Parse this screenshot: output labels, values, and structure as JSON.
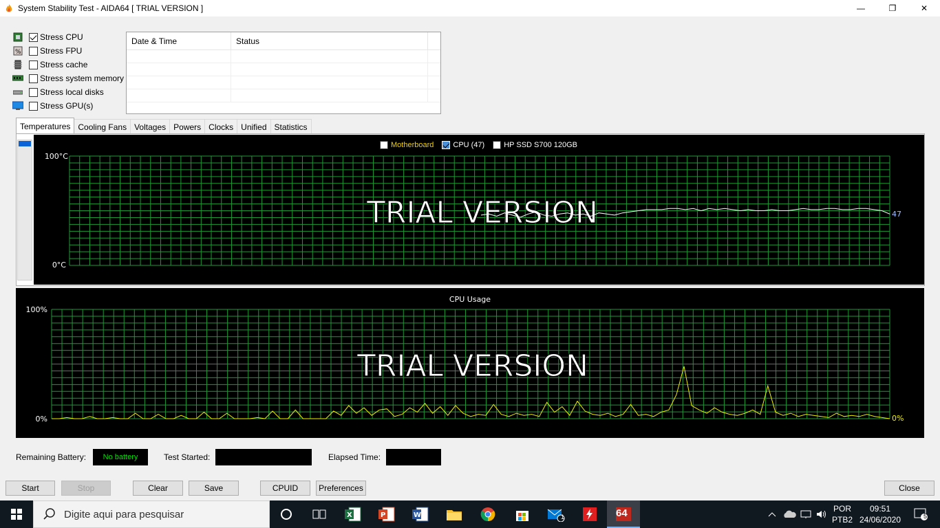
{
  "window": {
    "title": "System Stability Test - AIDA64  [ TRIAL VERSION ]",
    "minimize": "—",
    "maximize": "❐",
    "close": "✕"
  },
  "stress_options": [
    {
      "label": "Stress CPU",
      "checked": true,
      "icon": "cpu-icon"
    },
    {
      "label": "Stress FPU",
      "checked": false,
      "icon": "fpu-icon"
    },
    {
      "label": "Stress cache",
      "checked": false,
      "icon": "cache-icon"
    },
    {
      "label": "Stress system memory",
      "checked": false,
      "icon": "memory-icon"
    },
    {
      "label": "Stress local disks",
      "checked": false,
      "icon": "disk-icon"
    },
    {
      "label": "Stress GPU(s)",
      "checked": false,
      "icon": "gpu-icon"
    }
  ],
  "log": {
    "columns": [
      "Date & Time",
      "Status"
    ]
  },
  "tabs": [
    "Temperatures",
    "Cooling Fans",
    "Voltages",
    "Powers",
    "Clocks",
    "Unified",
    "Statistics"
  ],
  "temp_graph": {
    "legend": [
      {
        "label": "Motherboard",
        "checked": false,
        "color": "#f0d000"
      },
      {
        "label": "CPU (47)",
        "checked": true,
        "color": "#ffffff"
      },
      {
        "label": "HP SSD S700 120GB",
        "checked": false,
        "color": "#ffffff"
      }
    ],
    "y_top": "100°C",
    "y_bottom": "0°C",
    "current": "47",
    "watermark": "TRIAL VERSION"
  },
  "cpu_graph": {
    "title": "CPU Usage",
    "y_top": "100%",
    "y_bottom": "0%",
    "current": "0%",
    "watermark": "TRIAL VERSION"
  },
  "chart_data": [
    {
      "type": "line",
      "title": "",
      "ylim": [
        0,
        100
      ],
      "series": [
        {
          "name": "CPU (47)",
          "values": [
            46,
            47,
            45,
            48,
            46,
            44,
            47,
            49,
            46,
            45,
            47,
            48,
            46,
            47,
            45,
            48,
            47,
            46,
            48,
            49,
            50,
            51,
            51,
            51,
            52,
            52,
            51,
            52,
            50,
            52,
            51,
            52,
            51,
            50,
            51,
            50,
            50,
            51,
            50,
            50,
            51,
            52,
            51,
            51,
            52,
            52,
            51,
            51,
            52,
            52,
            51,
            50,
            47
          ]
        }
      ]
    },
    {
      "type": "line",
      "title": "CPU Usage",
      "ylim": [
        0,
        100
      ],
      "series": [
        {
          "name": "CPU Usage",
          "values": [
            0,
            0,
            1,
            0,
            0,
            2,
            0,
            0,
            1,
            0,
            0,
            5,
            0,
            0,
            4,
            0,
            0,
            3,
            0,
            0,
            6,
            0,
            0,
            5,
            0,
            0,
            0,
            1,
            0,
            7,
            0,
            0,
            8,
            0,
            0,
            0,
            0,
            7,
            3,
            12,
            5,
            10,
            3,
            8,
            9,
            2,
            4,
            10,
            6,
            14,
            5,
            11,
            3,
            12,
            5,
            2,
            4,
            3,
            13,
            4,
            2,
            5,
            3,
            4,
            2,
            15,
            6,
            11,
            3,
            16,
            7,
            4,
            3,
            5,
            2,
            4,
            13,
            3,
            4,
            2,
            6,
            8,
            22,
            48,
            12,
            8,
            5,
            10,
            6,
            4,
            3,
            5,
            8,
            4,
            30,
            6,
            3,
            5,
            2,
            4,
            3,
            2,
            1,
            5,
            2,
            3,
            2,
            4,
            2,
            1,
            0
          ]
        }
      ]
    }
  ],
  "status": {
    "battery_label": "Remaining Battery:",
    "battery_value": "No battery",
    "test_started_label": "Test Started:",
    "test_started_value": "",
    "elapsed_label": "Elapsed Time:",
    "elapsed_value": ""
  },
  "buttons": {
    "start": "Start",
    "stop": "Stop",
    "clear": "Clear",
    "save": "Save",
    "cpuid": "CPUID",
    "preferences": "Preferences",
    "close": "Close"
  },
  "taskbar": {
    "search_placeholder": "Digite aqui para pesquisar",
    "lang1": "POR",
    "lang2": "PTB2",
    "time": "09:51",
    "date": "24/06/2020",
    "notif_count": "5",
    "mail_badge": "1",
    "aida_label": "64"
  }
}
